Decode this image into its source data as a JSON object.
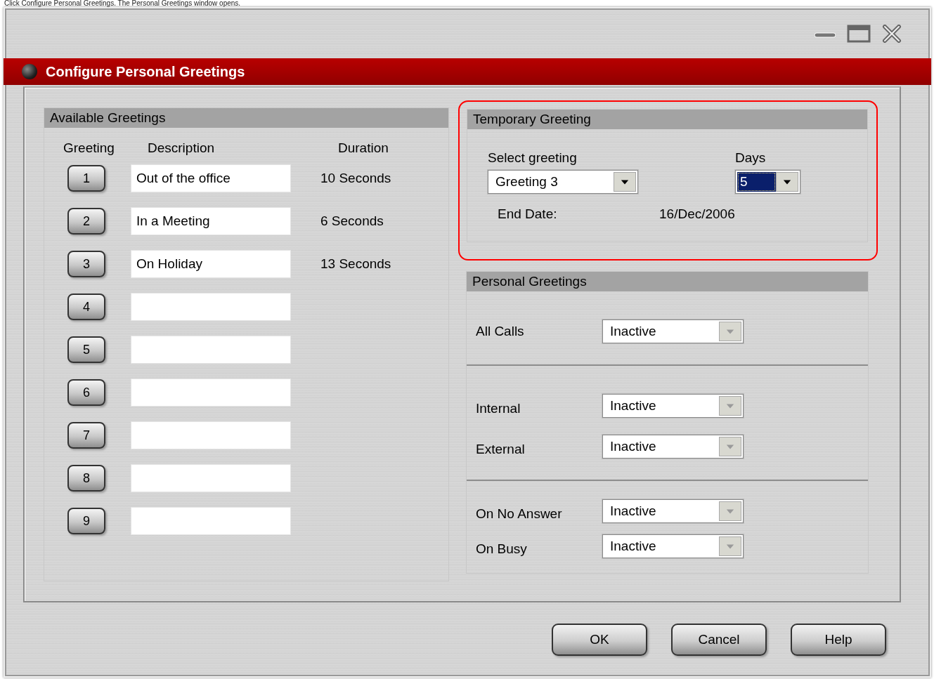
{
  "caption": "Click Configure Personal Greetings. The Personal Greetings window opens.",
  "window": {
    "title": "Configure Personal Greetings"
  },
  "available_greetings": {
    "title": "Available Greetings",
    "columns": [
      "Greeting",
      "Description",
      "Duration"
    ],
    "rows": [
      {
        "number": "1",
        "description": "Out of the office",
        "duration": "10 Seconds"
      },
      {
        "number": "2",
        "description": "In a Meeting",
        "duration": "6 Seconds"
      },
      {
        "number": "3",
        "description": "On Holiday",
        "duration": "13 Seconds"
      },
      {
        "number": "4"
      },
      {
        "number": "5"
      },
      {
        "number": "6"
      },
      {
        "number": "7"
      },
      {
        "number": "8"
      },
      {
        "number": "9"
      }
    ]
  },
  "temporary_greeting": {
    "title": "Temporary Greeting",
    "highlighted": true,
    "select_label": "Select greeting",
    "select": {
      "value": "Greeting 3",
      "disabled": false
    },
    "days_label": "Days",
    "days": {
      "value": "5",
      "focused": true,
      "disabled": false
    },
    "end_date_label": "End Date:",
    "end_date": "16/Dec/2006"
  },
  "personal_greetings": {
    "title": "Personal Greetings",
    "groups": [
      {
        "rows": [
          {
            "label": "All Calls",
            "value": "Inactive",
            "disabled": true
          }
        ]
      },
      {
        "rows": [
          {
            "label": "Internal",
            "value": "Inactive",
            "disabled": true
          },
          {
            "label": "External",
            "value": "Inactive",
            "disabled": true
          }
        ]
      },
      {
        "rows": [
          {
            "label": "On No Answer",
            "value": "Inactive",
            "disabled": true
          },
          {
            "label": "On Busy",
            "value": "Inactive",
            "disabled": true
          }
        ]
      }
    ]
  },
  "buttons": [
    "OK",
    "Cancel",
    "Help"
  ]
}
